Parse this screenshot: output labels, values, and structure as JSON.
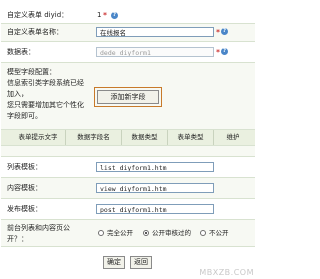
{
  "form": {
    "diyid": {
      "label": "自定义表单 diyid：",
      "value": "1"
    },
    "name": {
      "label": "自定义表单名称：",
      "value": "在线报名",
      "required": "*"
    },
    "table": {
      "label": "数据表：",
      "value": "dede_diyform1",
      "required": "*"
    },
    "model": {
      "label_line1": "模型字段配置：",
      "label_line2": "信息索引类字段系统已经",
      "label_line3": "加入，",
      "label_line4": "您只需要增加其它个性化",
      "label_line5": "字段即可。",
      "add_button": "添加新字段"
    },
    "field_table": {
      "headers": [
        "表单提示文字",
        "数据字段名",
        "数据类型",
        "表单类型",
        "维护"
      ]
    },
    "list_template": {
      "label": "列表模板：",
      "value": "list_diyform1.htm"
    },
    "view_template": {
      "label": "内容模板：",
      "value": "view_diyform1.htm"
    },
    "post_template": {
      "label": "发布模板：",
      "value": "post_diyform1.htm"
    },
    "public": {
      "label_line1": "前台列表和内容页公",
      "label_line2": "开？：",
      "options": [
        "完全公开",
        "公开审核过的",
        "不公开"
      ],
      "selected": "公开审核过的"
    }
  },
  "actions": {
    "confirm": "确定",
    "back": "返回"
  },
  "watermark": "MBXZB.COM"
}
